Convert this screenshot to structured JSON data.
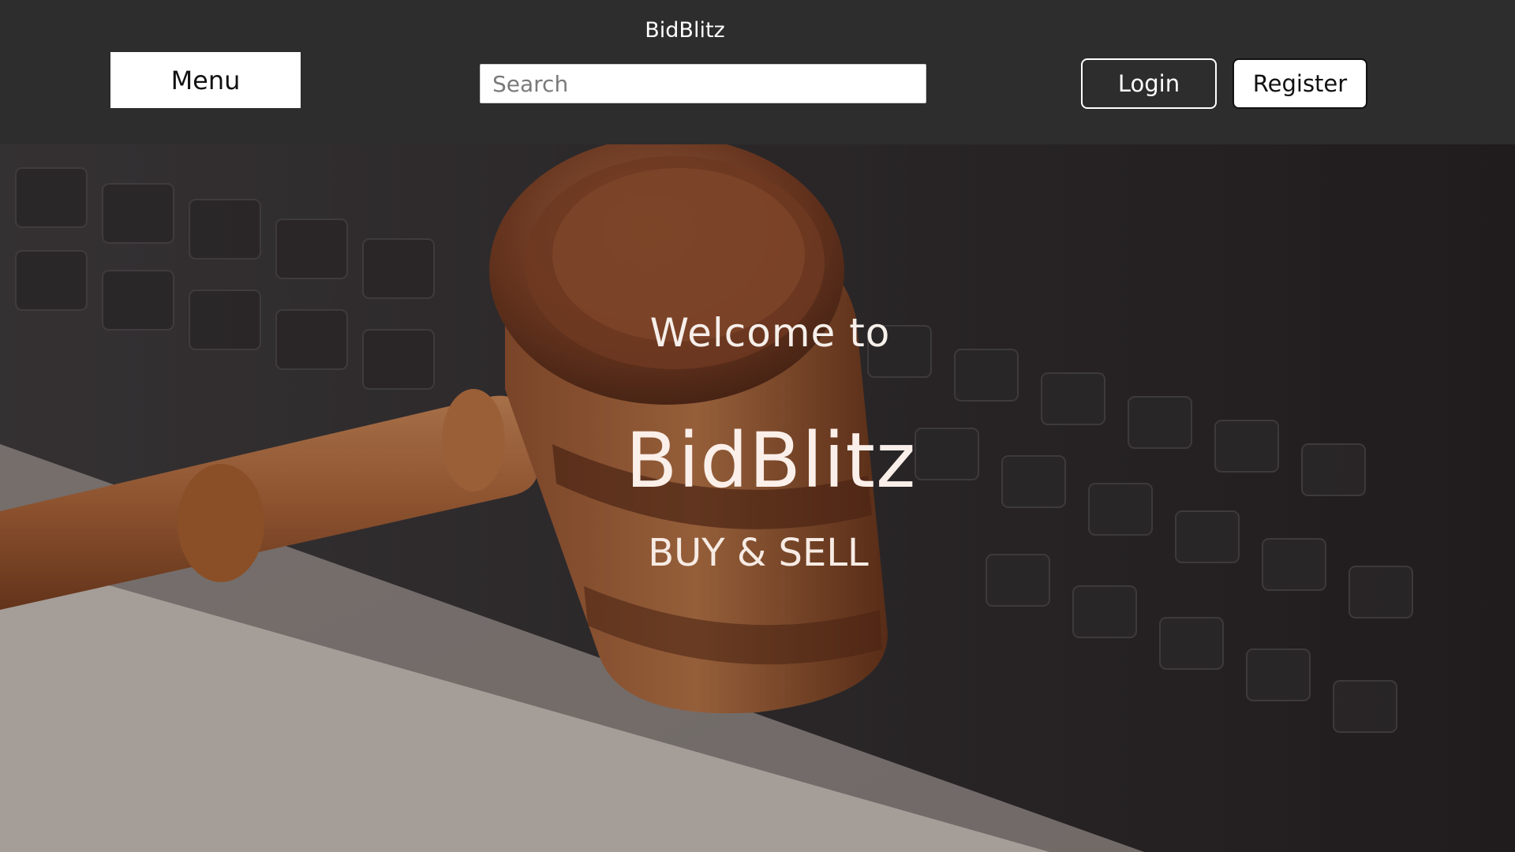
{
  "header": {
    "brand": "BidBlitz",
    "menu_label": "Menu",
    "search": {
      "placeholder": "Search",
      "value": ""
    },
    "login_label": "Login",
    "register_label": "Register"
  },
  "hero": {
    "welcome": "Welcome to",
    "title": "BidBlitz",
    "tagline": "BUY & SELL",
    "image": "auction-gavel-on-keyboard"
  },
  "colors": {
    "header_bg": "#2d2d2d",
    "button_white": "#ffffff",
    "gavel_wood": "#8a4a2a",
    "keyboard_dark": "#2a2a2e"
  }
}
